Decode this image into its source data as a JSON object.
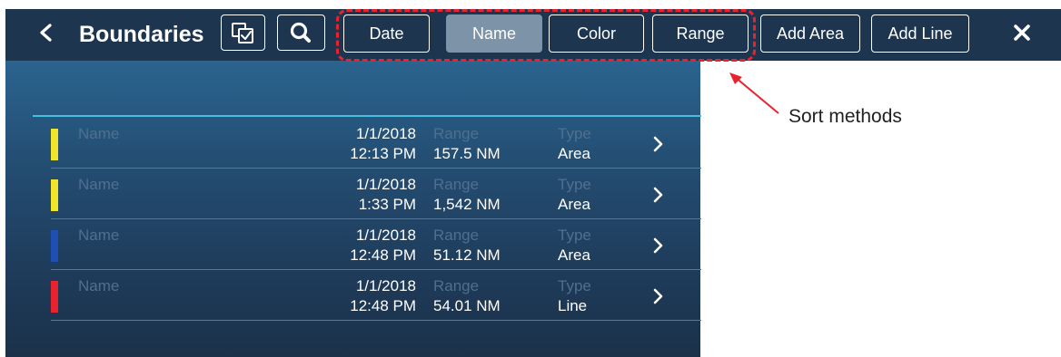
{
  "header": {
    "title": "Boundaries"
  },
  "sort": {
    "buttons": [
      {
        "label": "Date"
      },
      {
        "label": "Name"
      },
      {
        "label": "Color"
      },
      {
        "label": "Range"
      }
    ],
    "active": "Name"
  },
  "actions": {
    "add_area": "Add Area",
    "add_line": "Add Line"
  },
  "icons": {
    "back": "chevron-left-icon",
    "select": "multi-select-icon",
    "search": "search-icon",
    "close": "close-icon",
    "row": "chevron-right-icon"
  },
  "list": {
    "rows": [
      {
        "name_label": "Name",
        "date": "1/1/2018",
        "time": "12:13 PM",
        "range_label": "Range",
        "range": "157.5 NM",
        "type_label": "Type",
        "type": "Area",
        "color": "#f0e52a"
      },
      {
        "name_label": "Name",
        "date": "1/1/2018",
        "time": "1:33 PM",
        "range_label": "Range",
        "range": "1,542 NM",
        "type_label": "Type",
        "type": "Area",
        "color": "#f0e52a"
      },
      {
        "name_label": "Name",
        "date": "1/1/2018",
        "time": "12:48 PM",
        "range_label": "Range",
        "range": "51.12 NM",
        "type_label": "Type",
        "type": "Area",
        "color": "#1f4fb5"
      },
      {
        "name_label": "Name",
        "date": "1/1/2018",
        "time": "12:48 PM",
        "range_label": "Range",
        "range": "54.01 NM",
        "type_label": "Type",
        "type": "Line",
        "color": "#e8232f"
      }
    ]
  },
  "annotation": {
    "label": "Sort methods"
  },
  "colors": {
    "toolbar": "#1e3550",
    "active_sort": "#7d93a8",
    "highlight": "#e8232f",
    "divider": "#47c0e0"
  }
}
